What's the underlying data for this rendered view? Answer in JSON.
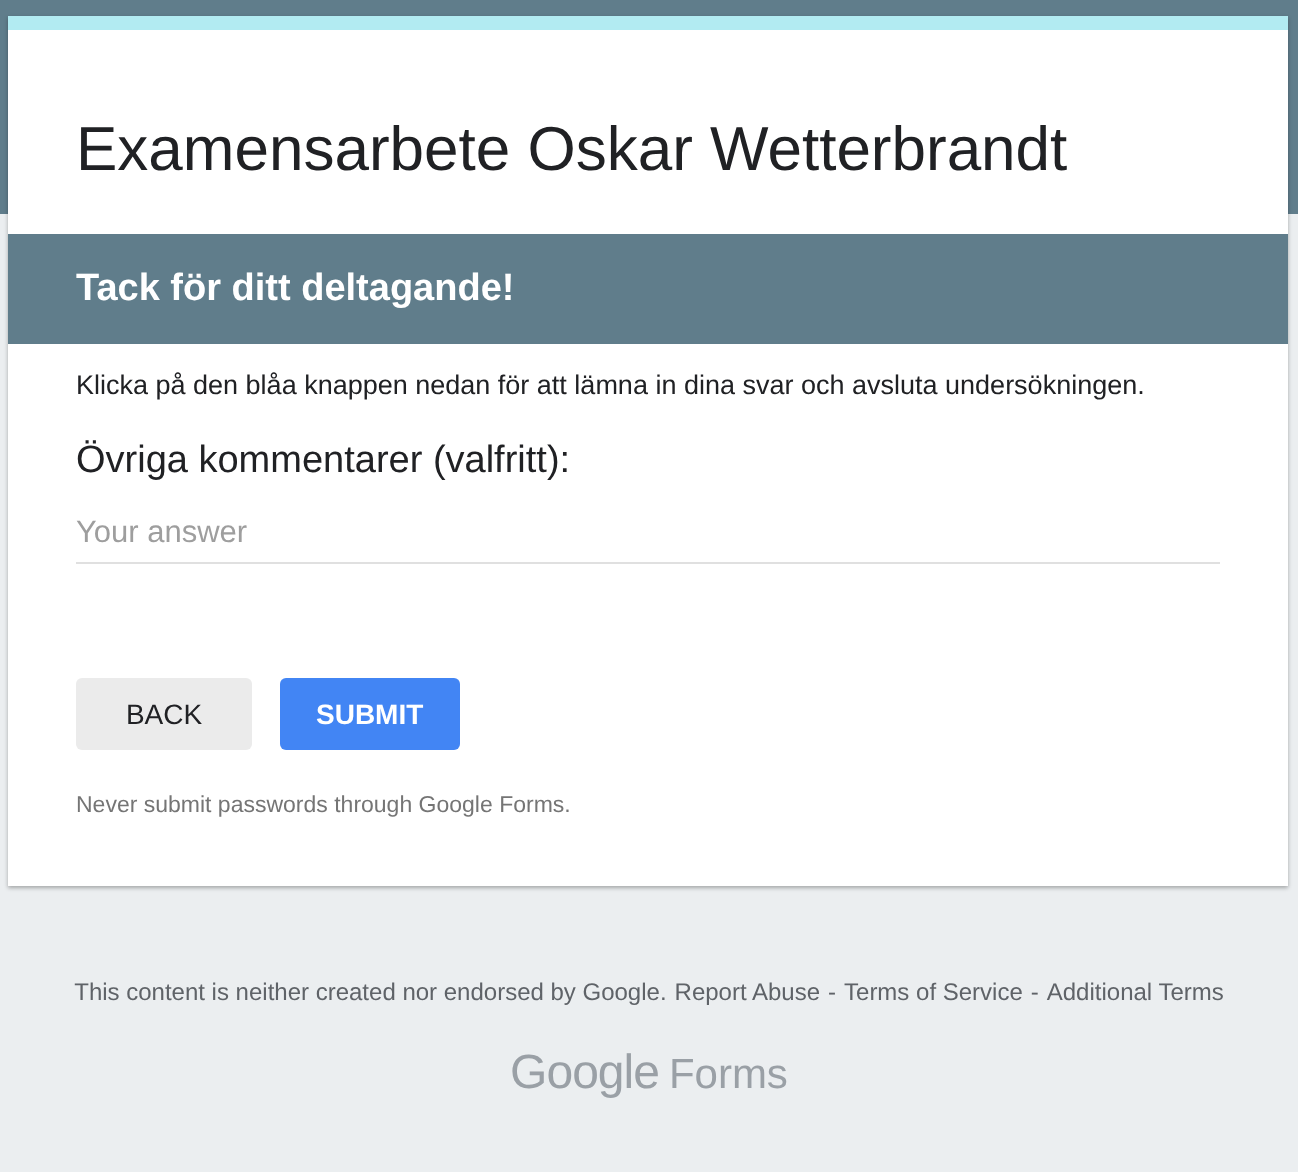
{
  "form": {
    "title": "Examensarbete Oskar Wetterbrandt"
  },
  "section": {
    "title": "Tack för ditt deltagande!",
    "description": "Klicka på den blåa knappen nedan för att lämna in dina svar och avsluta undersökningen."
  },
  "question": {
    "label": "Övriga kommentarer (valfritt):",
    "placeholder": "Your answer"
  },
  "buttons": [
    {
      "label": "BACK",
      "kind": "secondary"
    },
    {
      "label": "SUBMIT",
      "kind": "primary"
    }
  ],
  "warning": "Never submit passwords through Google Forms.",
  "footer": {
    "disclaimer": "This content is neither created nor endorsed by Google.",
    "links": [
      "Report Abuse",
      "Terms of Service",
      "Additional Terms"
    ],
    "separator": "-",
    "logo_word": "Google",
    "logo_product": "Forms"
  }
}
